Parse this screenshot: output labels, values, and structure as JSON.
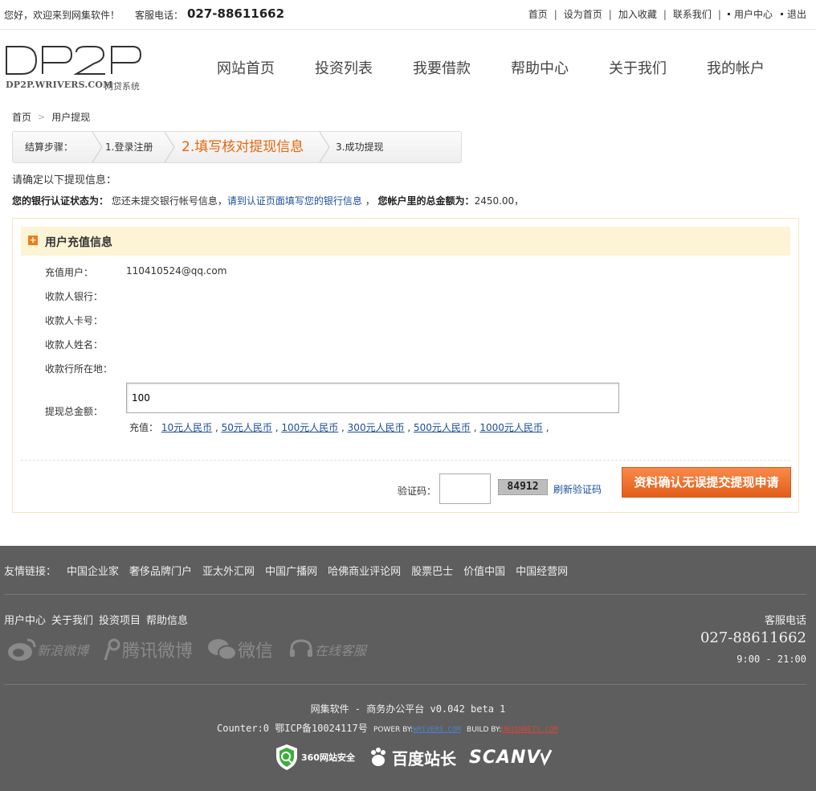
{
  "topbar": {
    "welcome": "您好，欢迎来到网集软件！",
    "phone_label": "客服电话：",
    "phone": "027-88611662",
    "links": [
      "首页",
      "设为首页",
      "加入收藏",
      "联系我们",
      "用户中心",
      "退出"
    ]
  },
  "header": {
    "logo_text": "DP2P",
    "logo_domain": "DP2P.WRIVERS.COM",
    "logo_sub": "网贷系统",
    "nav": [
      "网站首页",
      "投资列表",
      "我要借款",
      "帮助中心",
      "关于我们",
      "我的帐户"
    ]
  },
  "breadcrumb": [
    "首页",
    "用户提现"
  ],
  "steps": {
    "label": "结算步骤：",
    "items": [
      "1.登录注册",
      "2.填写核对提现信息",
      "3.成功提现"
    ],
    "active_index": 1
  },
  "confirm_title": "请确定以下提现信息：",
  "status": {
    "bank_label": "您的银行认证状态为：",
    "bank_text": "您还未提交银行帐号信息，",
    "bank_link": "请到认证页面填写您的银行信息",
    "sep": "，",
    "total_label": "您帐户里的总金额为：",
    "total_value": "2450.00，"
  },
  "panel": {
    "title": "用户充值信息",
    "fields": [
      {
        "label": "充值用户：",
        "value": "110410524@qq.com"
      },
      {
        "label": "收款人银行：",
        "value": ""
      },
      {
        "label": "收款人卡号：",
        "value": ""
      },
      {
        "label": "收款人姓名：",
        "value": ""
      },
      {
        "label": "收款行所在地：",
        "value": ""
      }
    ],
    "amount_label": "提现总金额：",
    "amount_value": "100",
    "quick_label": "充值：",
    "quick_options": [
      "10元人民币",
      "50元人民币",
      "100元人民币",
      "300元人民币",
      "500元人民币",
      "1000元人民币"
    ],
    "captcha_label": "验证码：",
    "captcha_code": "84912",
    "refresh_label": "刷新验证码",
    "submit_label": "资料确认无误提交提现申请"
  },
  "footer": {
    "friend_label": "友情链接：",
    "friend_links": [
      "中国企业家",
      "奢侈品牌门户",
      "亚太外汇网",
      "中国广播网",
      "哈佛商业评论网",
      "股票巴士",
      "价值中国",
      "中国经营网"
    ],
    "links": [
      "用户中心",
      "关于我们",
      "投资项目",
      "帮助信息"
    ],
    "socials": [
      "新浪微博",
      "腾讯微博",
      "微信",
      "在线客服"
    ],
    "cs_label": "客服电话",
    "cs_phone": "027-88611662",
    "cs_hours": "9:00 - 21:00",
    "copyright": "网集软件 - 商务办公平台 v0.042 beta 1",
    "counter": "Counter:0 鄂ICP备10024117号",
    "power_by": "POWER BY:",
    "power_link": "WRIVERS.COM",
    "build_by": "BUILD BY:",
    "build_link": "UNIONNETS.COM",
    "badges": [
      "360网站安全",
      "百度站长",
      "SCANV"
    ]
  },
  "colors": {
    "accent_orange": "#e8650b",
    "link_blue": "#1a4e9c",
    "footer_bg": "#5e5e5e",
    "panel_head_bg": "#fdf4d6"
  }
}
